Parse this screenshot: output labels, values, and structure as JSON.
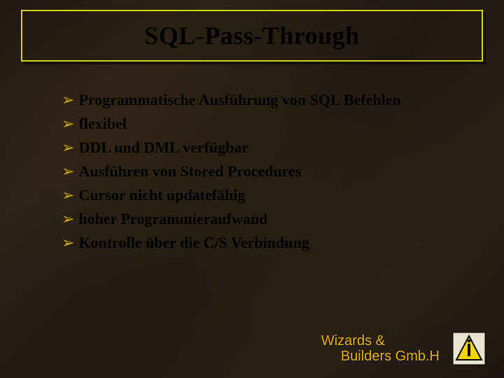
{
  "title": "SQL-Pass-Through",
  "bullets": [
    "Programmatische Ausführung von SQL Befehlen",
    "flexibel",
    "DDL und DML verfügbar",
    "Ausführen von Stored Procedures",
    "Cursor nicht updatefähig",
    "hoher Programmieraufwand",
    "Kontrolle über die C/S Verbindung"
  ],
  "bullet_glyph": "➢",
  "footer": {
    "line1": "Wizards &",
    "line2": "Builders Gmb.H"
  }
}
